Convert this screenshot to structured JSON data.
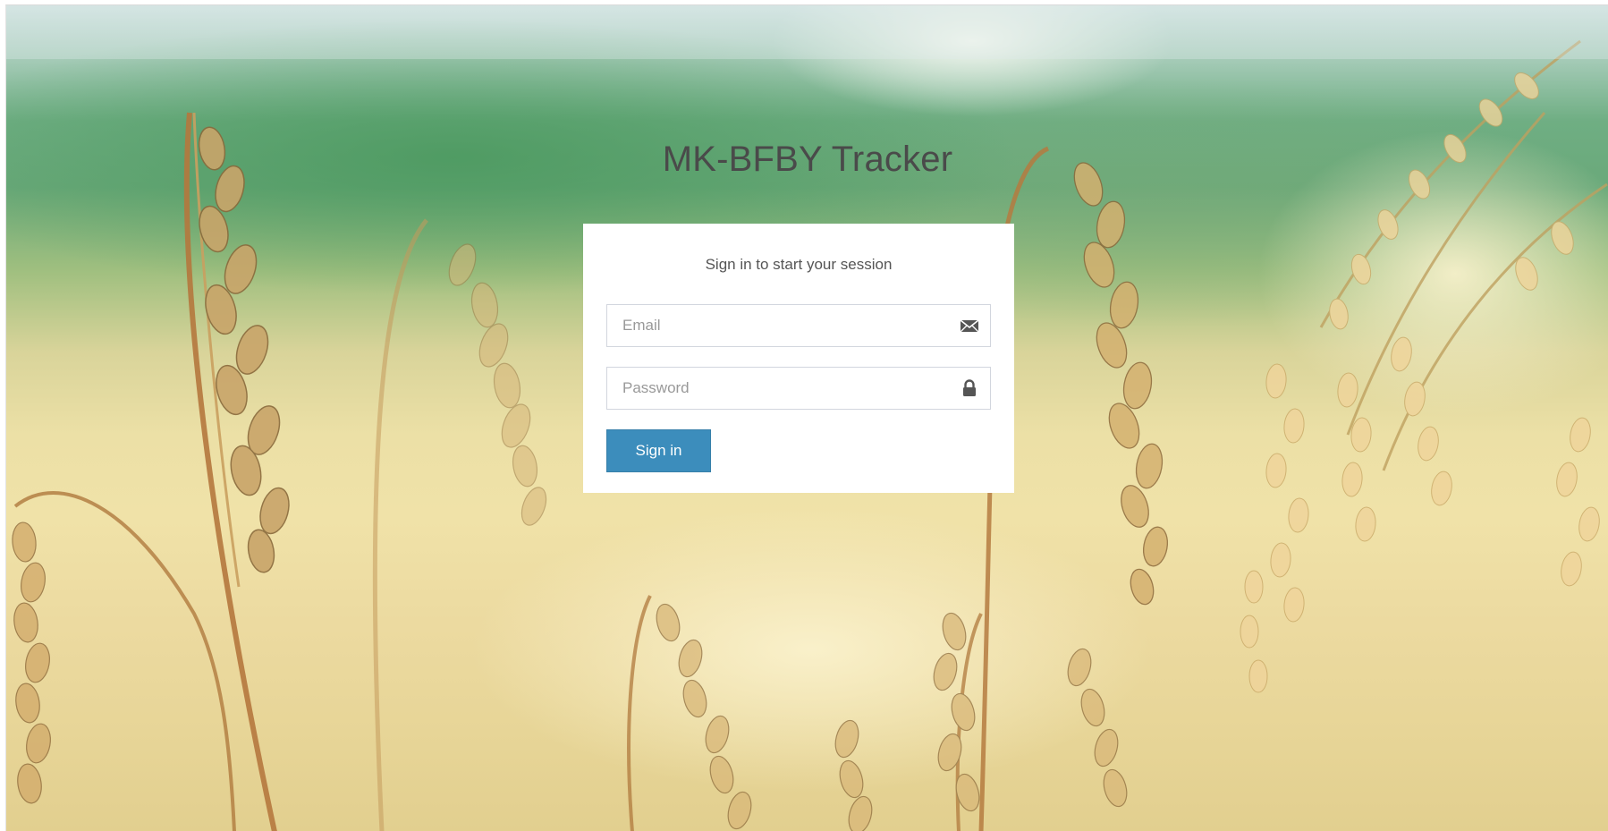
{
  "app": {
    "title": "MK-BFBY Tracker"
  },
  "login": {
    "message": "Sign in to start your session",
    "email": {
      "placeholder": "Email",
      "value": "",
      "icon": "envelope-icon"
    },
    "password": {
      "placeholder": "Password",
      "value": "",
      "icon": "lock-icon"
    },
    "submit_label": "Sign in"
  },
  "colors": {
    "primary_button": "#3c8dbc",
    "title_text": "#4a4a4a",
    "box_background": "#ffffff"
  }
}
